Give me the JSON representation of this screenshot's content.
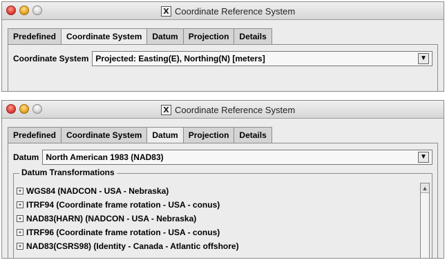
{
  "window1": {
    "title": "Coordinate Reference System",
    "title_icon": "x11-icon",
    "tabs": [
      {
        "label": "Predefined",
        "active": false
      },
      {
        "label": "Coordinate System",
        "active": true
      },
      {
        "label": "Datum",
        "active": false
      },
      {
        "label": "Projection",
        "active": false
      },
      {
        "label": "Details",
        "active": false
      }
    ],
    "coordinate_system": {
      "label": "Coordinate System",
      "value": "Projected: Easting(E), Northing(N) [meters]"
    }
  },
  "window2": {
    "title": "Coordinate Reference System",
    "title_icon": "x11-icon",
    "tabs": [
      {
        "label": "Predefined",
        "active": false
      },
      {
        "label": "Coordinate System",
        "active": false
      },
      {
        "label": "Datum",
        "active": true
      },
      {
        "label": "Projection",
        "active": false
      },
      {
        "label": "Details",
        "active": false
      }
    ],
    "datum": {
      "label": "Datum",
      "value": "North American 1983 (NAD83)"
    },
    "transformations": {
      "title": "Datum Transformations",
      "items": [
        "WGS84 (NADCON - USA - Nebraska)",
        "ITRF94 (Coordinate frame rotation - USA - conus)",
        "NAD83(HARN) (NADCON - USA - Nebraska)",
        "ITRF96 (Coordinate frame rotation - USA - conus)",
        "NAD83(CSRS98) (Identity - Canada - Atlantic offshore)"
      ]
    }
  },
  "glyphs": {
    "dropdown_arrow": "▼",
    "expander": "+",
    "scroll_up": "▲",
    "x_icon": "X"
  },
  "colors": {
    "window_bg": "#ececec",
    "close": "#e0443a",
    "minimize": "#e8a92c"
  }
}
